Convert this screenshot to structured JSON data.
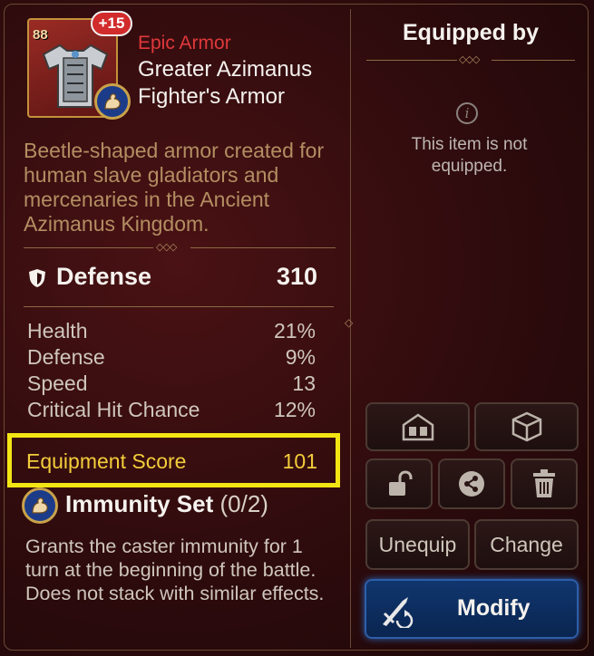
{
  "item": {
    "level": "88",
    "enhancement": "+15",
    "rarity": "Epic Armor",
    "name_line1": "Greater Azimanus",
    "name_line2": "Fighter's Armor",
    "description": "Beetle-shaped armor created for human slave gladiators and mercenaries in the Ancient Azimanus Kingdom.",
    "main_stat": {
      "label": "Defense",
      "value": "310"
    },
    "substats": [
      {
        "label": "Health",
        "value": "21%"
      },
      {
        "label": "Defense",
        "value": "9%"
      },
      {
        "label": "Speed",
        "value": "13"
      },
      {
        "label": "Critical Hit Chance",
        "value": "12%"
      }
    ],
    "equipment_score": {
      "label": "Equipment Score",
      "value": "101"
    },
    "set": {
      "name": "Immunity Set",
      "count": "(0/2)",
      "description": "Grants the caster immunity for 1 turn at the beginning of the battle. Does not stack with similar effects."
    }
  },
  "panel": {
    "title": "Equipped by",
    "empty_message": "This item is not equipped.",
    "buttons": {
      "unequip": "Unequip",
      "change": "Change",
      "modify": "Modify"
    }
  },
  "colors": {
    "rarity": "#e0383b",
    "description": "#b38e62",
    "score_highlight": "#f3e514",
    "modify_button": "#10366e"
  }
}
